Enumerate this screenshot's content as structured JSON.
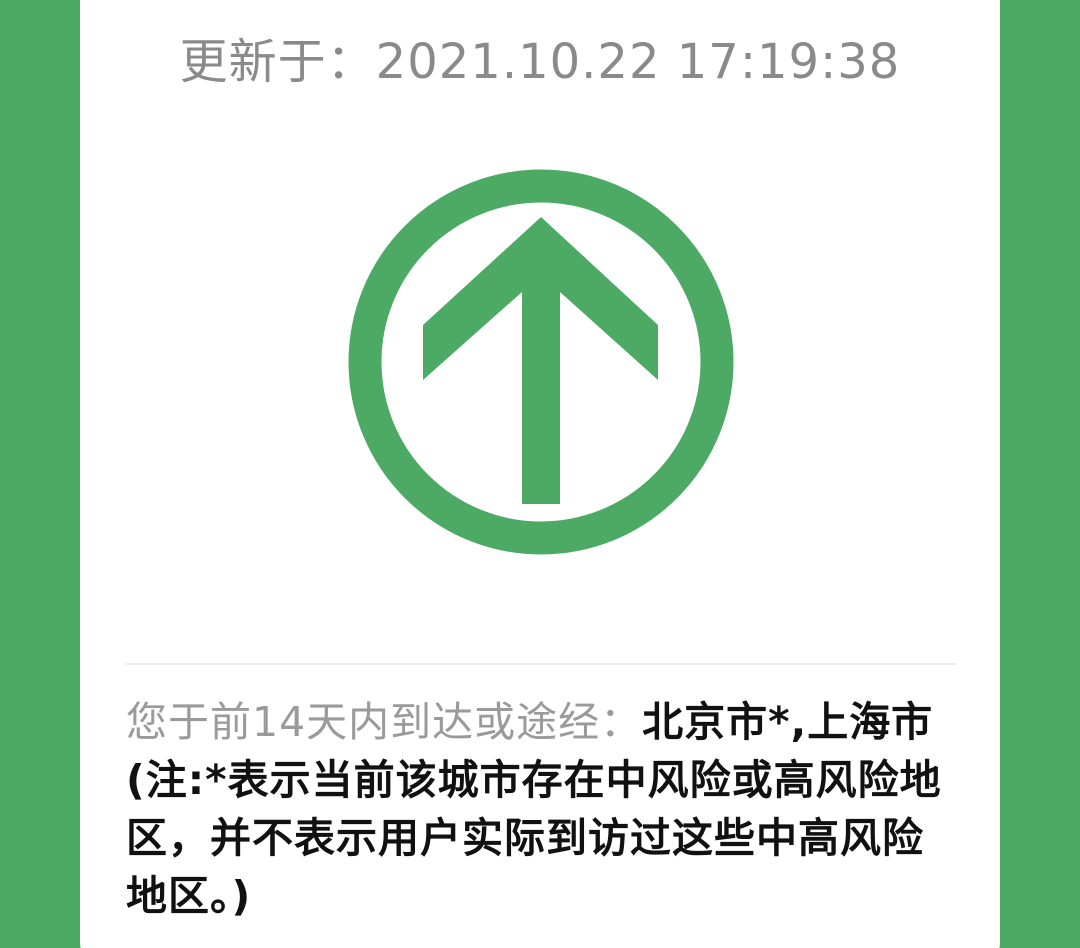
{
  "header": {
    "update_label": "更新于：",
    "update_time": "2021.10.22 17:19:38"
  },
  "status": {
    "icon": "arrow-up-circle-icon",
    "color": "#4caa64"
  },
  "travel": {
    "prefix": "您于前14天内到达或途经：",
    "cities": "北京市*,上海市(注:*表示当前该城市存在中风险或高风险地区，并不表示用户实际到访过这些中高风险地区。)"
  },
  "theme": {
    "background": "#4caa64",
    "card": "#ffffff"
  }
}
